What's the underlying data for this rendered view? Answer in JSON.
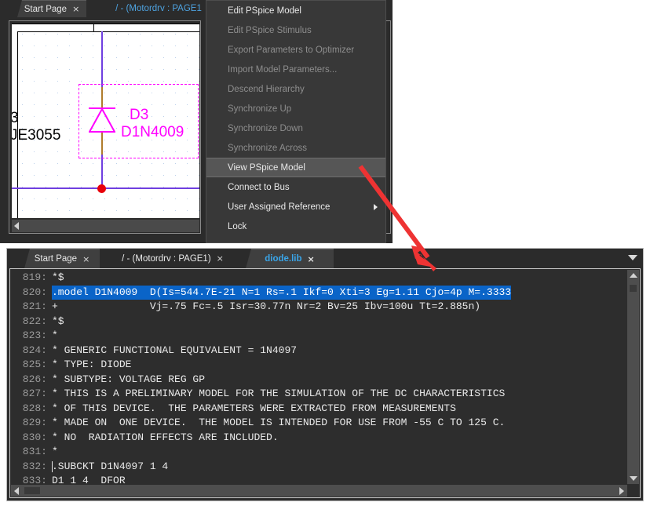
{
  "colors": {
    "accent_blue": "#3aa5e8",
    "selection_blue": "#0a64c8",
    "schematic_magenta": "#ff00ff",
    "wire_purple": "#6f3fe0",
    "pin_tan": "#b07c2c",
    "junction_red": "#e8000b",
    "annotation_red": "#ee3333",
    "menu_bg": "#383838",
    "menu_highlight": "#565656",
    "editor_bg": "#2d2d2d"
  },
  "top_window": {
    "tabs": [
      {
        "label": "Start Page",
        "close": "×",
        "active": false
      },
      {
        "label": "/ - (Motordrv : PAGE1",
        "close": "",
        "active": true
      }
    ],
    "schematic": {
      "labels": {
        "ref_des": "D3",
        "part_value": "D1N4009",
        "neighbor_ref": "3",
        "neighbor_part": "JE3055"
      }
    }
  },
  "context_menu": {
    "items": [
      {
        "label": "Edit PSpice Model",
        "enabled": true,
        "highlighted": false,
        "submenu": false
      },
      {
        "label": "Edit PSpice Stimulus",
        "enabled": false,
        "highlighted": false,
        "submenu": false
      },
      {
        "label": "Export Parameters to Optimizer",
        "enabled": false,
        "highlighted": false,
        "submenu": false
      },
      {
        "label": "Import Model Parameters...",
        "enabled": false,
        "highlighted": false,
        "submenu": false
      },
      {
        "label": "Descend Hierarchy",
        "enabled": false,
        "highlighted": false,
        "submenu": false
      },
      {
        "label": "Synchronize Up",
        "enabled": false,
        "highlighted": false,
        "submenu": false
      },
      {
        "label": "Synchronize Down",
        "enabled": false,
        "highlighted": false,
        "submenu": false
      },
      {
        "label": "Synchronize Across",
        "enabled": false,
        "highlighted": false,
        "submenu": false
      },
      {
        "label": "View PSpice Model",
        "enabled": true,
        "highlighted": true,
        "submenu": false
      },
      {
        "label": "Connect to Bus",
        "enabled": true,
        "highlighted": false,
        "submenu": false
      },
      {
        "label": "User Assigned Reference",
        "enabled": true,
        "highlighted": false,
        "submenu": true
      },
      {
        "label": "Lock",
        "enabled": true,
        "highlighted": false,
        "submenu": false
      }
    ]
  },
  "bottom_window": {
    "tabs": [
      {
        "label": "Start Page",
        "close": "×",
        "active": false
      },
      {
        "label": "/ - (Motordrv : PAGE1)",
        "close": "×",
        "active": false
      },
      {
        "label": "diode.lib",
        "close": "×",
        "active": true
      }
    ],
    "editor": {
      "first_line_number": 819,
      "lines": [
        {
          "n": "819",
          "text": "*$",
          "selected": false,
          "caret": false
        },
        {
          "n": "820",
          "text": ".model D1N4009  D(Is=544.7E-21 N=1 Rs=.1 Ikf=0 Xti=3 Eg=1.11 Cjo=4p M=.3333",
          "selected": true,
          "caret": false
        },
        {
          "n": "821",
          "text": "+               Vj=.75 Fc=.5 Isr=30.77n Nr=2 Bv=25 Ibv=100u Tt=2.885n)",
          "selected": false,
          "caret": false
        },
        {
          "n": "822",
          "text": "*$",
          "selected": false,
          "caret": false
        },
        {
          "n": "823",
          "text": "*",
          "selected": false,
          "caret": false
        },
        {
          "n": "824",
          "text": "* GENERIC FUNCTIONAL EQUIVALENT = 1N4097",
          "selected": false,
          "caret": false
        },
        {
          "n": "825",
          "text": "* TYPE: DIODE",
          "selected": false,
          "caret": false
        },
        {
          "n": "826",
          "text": "* SUBTYPE: VOLTAGE REG GP",
          "selected": false,
          "caret": false
        },
        {
          "n": "827",
          "text": "* THIS IS A PRELIMINARY MODEL FOR THE SIMULATION OF THE DC CHARACTERISTICS",
          "selected": false,
          "caret": false
        },
        {
          "n": "828",
          "text": "* OF THIS DEVICE.  THE PARAMETERS WERE EXTRACTED FROM MEASUREMENTS",
          "selected": false,
          "caret": false
        },
        {
          "n": "829",
          "text": "* MADE ON  ONE DEVICE.  THE MODEL IS INTENDED FOR USE FROM -55 C TO 125 C.",
          "selected": false,
          "caret": false
        },
        {
          "n": "830",
          "text": "* NO  RADIATION EFFECTS ARE INCLUDED.",
          "selected": false,
          "caret": false
        },
        {
          "n": "831",
          "text": "*",
          "selected": false,
          "caret": false
        },
        {
          "n": "832",
          "text": ".SUBCKT D1N4097 1 4",
          "selected": false,
          "caret": true
        },
        {
          "n": "833",
          "text": "D1 1 4  DFOR",
          "selected": false,
          "caret": false
        }
      ]
    }
  }
}
